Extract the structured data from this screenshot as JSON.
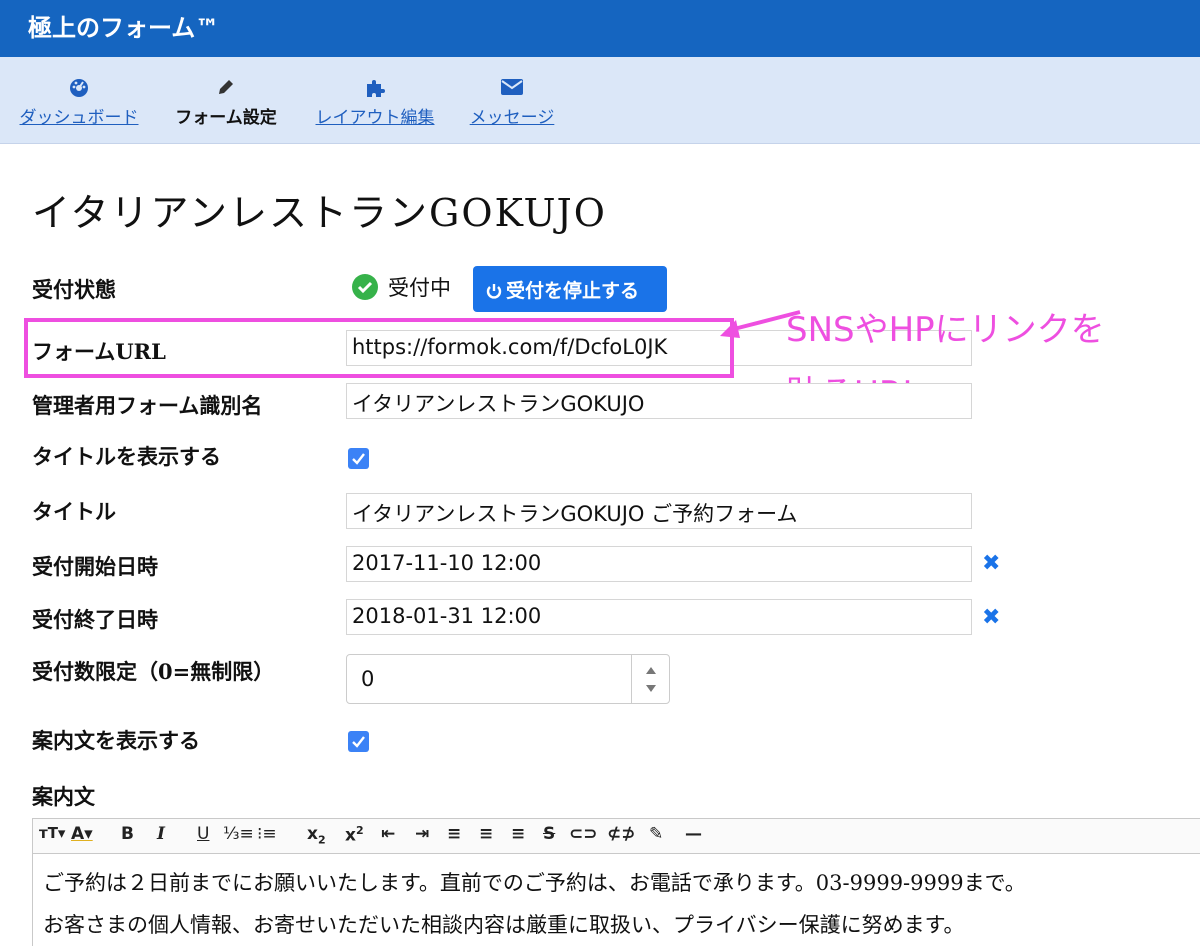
{
  "app": {
    "title": "極上のフォーム™"
  },
  "nav": {
    "items": [
      {
        "label": "ダッシュボード",
        "icon": "dashboard-icon"
      },
      {
        "label": "フォーム設定",
        "icon": "pencil-icon"
      },
      {
        "label": "レイアウト編集",
        "icon": "puzzle-icon"
      },
      {
        "label": "メッセージ",
        "icon": "envelope-icon"
      }
    ]
  },
  "page": {
    "heading": "イタリアンレストランGOKUJO"
  },
  "form": {
    "status": {
      "label": "受付状態",
      "value": "受付中",
      "stop_button": "受付を停止する"
    },
    "form_url": {
      "label": "フォームURL",
      "value": "https://formok.com/f/DcfoL0JK"
    },
    "admin_name": {
      "label": "管理者用フォーム識別名",
      "value": "イタリアンレストランGOKUJO"
    },
    "show_title": {
      "label": "タイトルを表示する",
      "checked": true
    },
    "title": {
      "label": "タイトル",
      "value": "イタリアンレストランGOKUJO ご予約フォーム"
    },
    "start_datetime": {
      "label": "受付開始日時",
      "value": "2017-11-10 12:00"
    },
    "end_datetime": {
      "label": "受付終了日時",
      "value": "2018-01-31 12:00"
    },
    "limit": {
      "label": "受付数限定（0=無制限）",
      "value": "0"
    },
    "show_guide": {
      "label": "案内文を表示する",
      "checked": true
    },
    "guide": {
      "label": "案内文",
      "lines": [
        "ご予約は２日前までにお願いいたします。直前でのご予約は、お電話で承ります。03-9999-9999まで。",
        "お客さまの個人情報、お寄せいただいた相談内容は厳重に取扱い、プライバシー保護に努めます。"
      ]
    }
  },
  "annotation": {
    "line1": "SNSやHPにリンクを",
    "line2": "貼るURL",
    "color": "#ee4fe0"
  },
  "colors": {
    "appbar": "#1565c0",
    "navbar": "#dbe7f8",
    "accent": "#1a73e8",
    "ok": "#36b24a"
  }
}
